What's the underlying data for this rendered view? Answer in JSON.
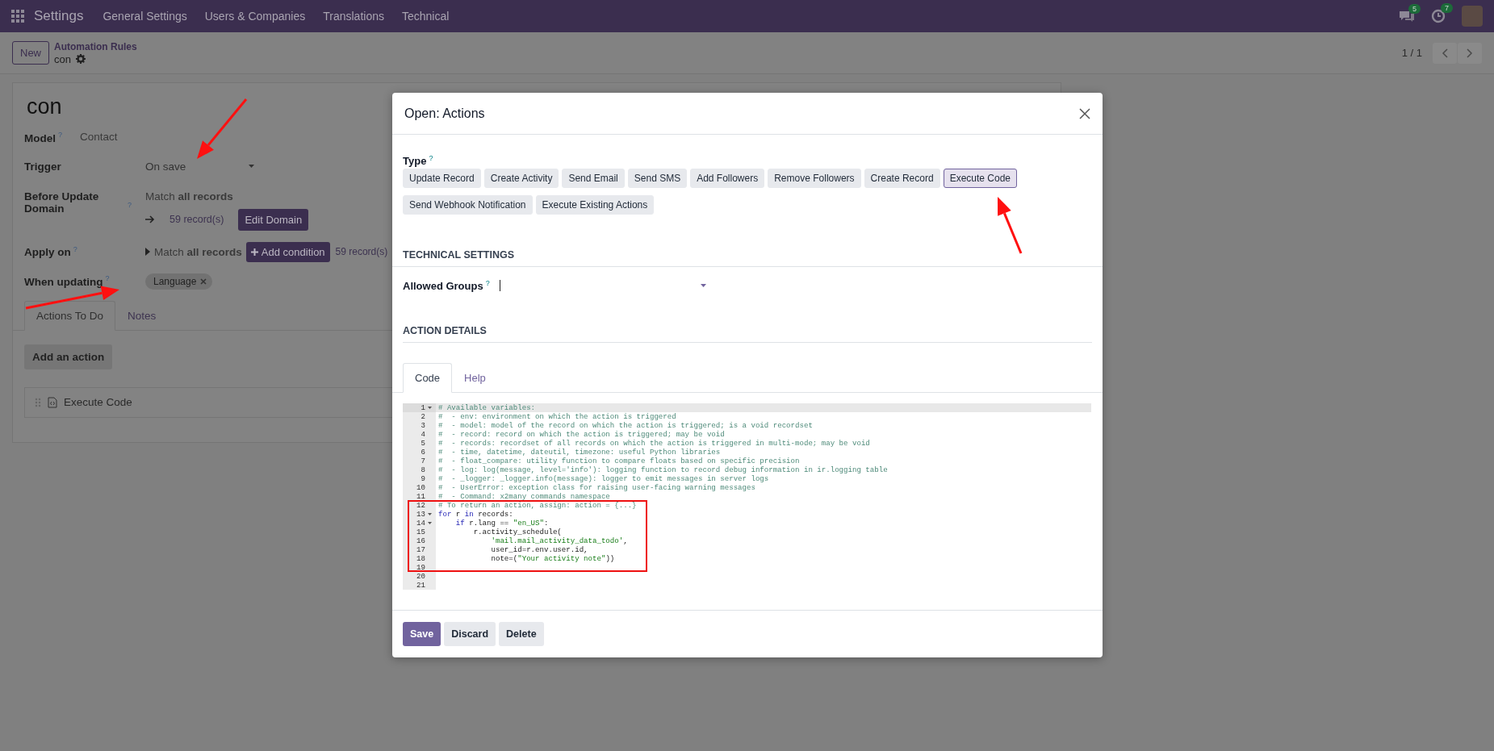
{
  "navbar": {
    "app_name": "Settings",
    "menu": [
      "General Settings",
      "Users & Companies",
      "Translations",
      "Technical"
    ],
    "messages_badge": "5",
    "activities_badge": "7"
  },
  "control_panel": {
    "new_button": "New",
    "breadcrumb": "Automation Rules",
    "record_name": "con",
    "pager": "1 / 1"
  },
  "form": {
    "title": "con",
    "model": {
      "label": "Model",
      "help": "?",
      "value": "Contact"
    },
    "trigger": {
      "label": "Trigger",
      "value": "On save"
    },
    "before_update_domain": {
      "label": "Before Update Domain",
      "help": "?",
      "summary": "Match **all records**",
      "record_count": "59 record(s)",
      "button": "Edit Domain"
    },
    "apply_on": {
      "label": "Apply on",
      "help": "?",
      "summary": "Match **all records**",
      "button": "Add condition",
      "record_count": "59 record(s)"
    },
    "when_updating": {
      "label": "When updating",
      "help": "?",
      "tags": [
        "Language"
      ]
    },
    "tabs": [
      {
        "label": "Actions To Do",
        "selected": true
      },
      {
        "label": "Notes",
        "selected": false
      }
    ],
    "add_button": "Add an action",
    "actions": [
      "Execute Code"
    ]
  },
  "dialog": {
    "title": "Open: Actions",
    "type_label": "Type",
    "type_help": "?",
    "types": [
      {
        "label": "Update Record",
        "selected": false
      },
      {
        "label": "Create Activity",
        "selected": false
      },
      {
        "label": "Send Email",
        "selected": false
      },
      {
        "label": "Send SMS",
        "selected": false
      },
      {
        "label": "Add Followers",
        "selected": false
      },
      {
        "label": "Remove Followers",
        "selected": false
      },
      {
        "label": "Create Record",
        "selected": false
      },
      {
        "label": "Execute Code",
        "selected": true
      },
      {
        "label": "Send Webhook Notification",
        "selected": false
      },
      {
        "label": "Execute Existing Actions",
        "selected": false
      }
    ],
    "technical_heading": "TECHNICAL SETTINGS",
    "allowed_groups": {
      "label": "Allowed Groups",
      "help": "?"
    },
    "details_heading": "ACTION DETAILS",
    "tabs": [
      {
        "label": "Code",
        "selected": true
      },
      {
        "label": "Help",
        "selected": false
      }
    ],
    "code_lines": [
      {
        "number": "1",
        "fold": true,
        "active": true,
        "tokens": [
          {
            "kind": "comment",
            "text": "# Available variables:"
          }
        ]
      },
      {
        "number": "2",
        "fold": false,
        "active": false,
        "tokens": [
          {
            "kind": "comment",
            "text": "#  - env: environment on which the action is triggered"
          }
        ]
      },
      {
        "number": "3",
        "fold": false,
        "active": false,
        "tokens": [
          {
            "kind": "comment",
            "text": "#  - model: model of the record on which the action is triggered; is a void recordset"
          }
        ]
      },
      {
        "number": "4",
        "fold": false,
        "active": false,
        "tokens": [
          {
            "kind": "comment",
            "text": "#  - record: record on which the action is triggered; may be void"
          }
        ]
      },
      {
        "number": "5",
        "fold": false,
        "active": false,
        "tokens": [
          {
            "kind": "comment",
            "text": "#  - records: recordset of all records on which the action is triggered in multi-mode; may be void"
          }
        ]
      },
      {
        "number": "6",
        "fold": false,
        "active": false,
        "tokens": [
          {
            "kind": "comment",
            "text": "#  - time, datetime, dateutil, timezone: useful Python libraries"
          }
        ]
      },
      {
        "number": "7",
        "fold": false,
        "active": false,
        "tokens": [
          {
            "kind": "comment",
            "text": "#  - float_compare: utility function to compare floats based on specific precision"
          }
        ]
      },
      {
        "number": "8",
        "fold": false,
        "active": false,
        "tokens": [
          {
            "kind": "comment",
            "text": "#  - log: log(message, level='info'): logging function to record debug information in ir.logging table"
          }
        ]
      },
      {
        "number": "9",
        "fold": false,
        "active": false,
        "tokens": [
          {
            "kind": "comment",
            "text": "#  - _logger: _logger.info(message): logger to emit messages in server logs"
          }
        ]
      },
      {
        "number": "10",
        "fold": false,
        "active": false,
        "tokens": [
          {
            "kind": "comment",
            "text": "#  - UserError: exception class for raising user-facing warning messages"
          }
        ]
      },
      {
        "number": "11",
        "fold": false,
        "active": false,
        "tokens": [
          {
            "kind": "comment",
            "text": "#  - Command: x2many commands namespace"
          }
        ]
      },
      {
        "number": "12",
        "fold": false,
        "active": false,
        "tokens": [
          {
            "kind": "comment",
            "text": "# To return an action, assign: action = {...}"
          }
        ]
      },
      {
        "number": "13",
        "fold": true,
        "active": false,
        "tokens": [
          {
            "kind": "keyword",
            "text": "for"
          },
          {
            "kind": "plain",
            "text": " r "
          },
          {
            "kind": "keyword",
            "text": "in"
          },
          {
            "kind": "plain",
            "text": " records:"
          }
        ]
      },
      {
        "number": "14",
        "fold": true,
        "active": false,
        "tokens": [
          {
            "kind": "keyword",
            "text": "    if"
          },
          {
            "kind": "plain",
            "text": " r.lang == "
          },
          {
            "kind": "string",
            "text": "\"en_US\""
          },
          {
            "kind": "plain",
            "text": ":"
          }
        ]
      },
      {
        "number": "15",
        "fold": false,
        "active": false,
        "tokens": [
          {
            "kind": "plain",
            "text": "        r.activity_schedule("
          }
        ]
      },
      {
        "number": "16",
        "fold": false,
        "active": false,
        "tokens": [
          {
            "kind": "string",
            "text": "            'mail.mail_activity_data_todo'"
          },
          {
            "kind": "plain",
            "text": ","
          }
        ]
      },
      {
        "number": "17",
        "fold": false,
        "active": false,
        "tokens": [
          {
            "kind": "plain",
            "text": "            user_id=r.env.user.id,"
          }
        ]
      },
      {
        "number": "18",
        "fold": false,
        "active": false,
        "tokens": [
          {
            "kind": "plain",
            "text": "            note=("
          },
          {
            "kind": "string",
            "text": "\"Your activity note\""
          },
          {
            "kind": "plain",
            "text": "))"
          }
        ]
      },
      {
        "number": "19",
        "fold": false,
        "active": false
      },
      {
        "number": "20",
        "fold": false,
        "active": false
      },
      {
        "number": "21",
        "fold": false,
        "active": false
      }
    ],
    "buttons": [
      {
        "label": "Save",
        "kind": "primary"
      },
      {
        "label": "Discard",
        "kind": "secondary"
      },
      {
        "label": "Delete",
        "kind": "secondary"
      }
    ]
  }
}
